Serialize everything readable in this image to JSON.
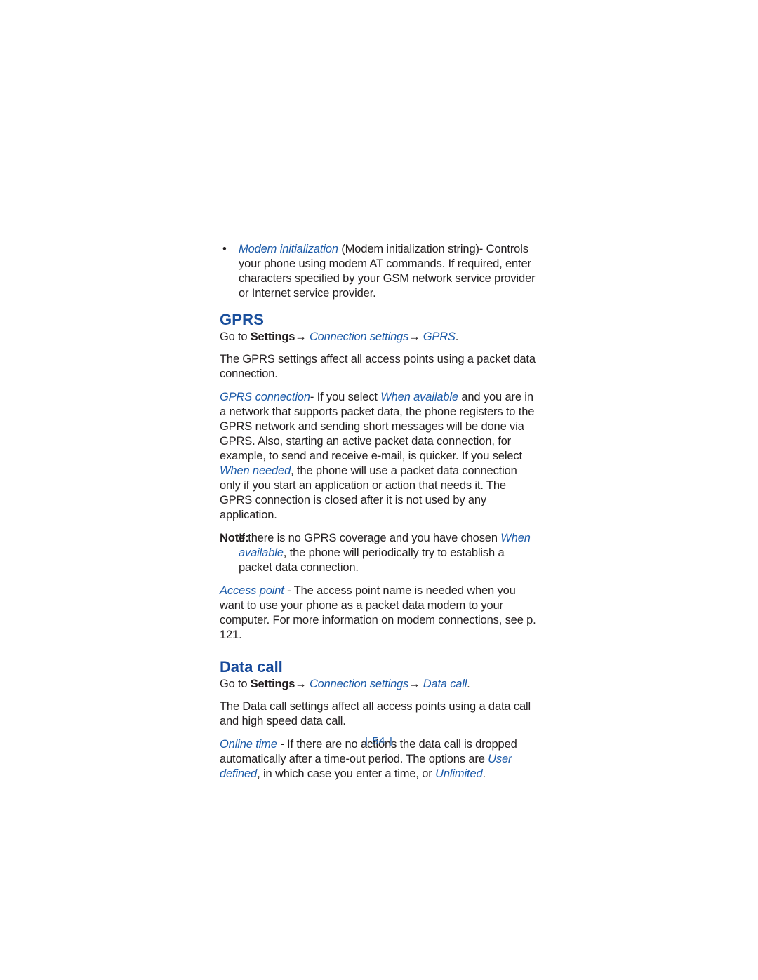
{
  "document": {
    "page_number_label": "[ 54 ]",
    "colors": {
      "heading_blue": "#1a4f9c",
      "inline_blue": "#1b5aa8",
      "body_text": "#231f20",
      "page_background": "#ffffff"
    }
  },
  "bullets": [
    {
      "marker": "•",
      "term": "Modem initialization",
      "rest": " (Modem initialization string)- Controls your phone using modem AT commands. If required, enter characters specified by your GSM network service provider or Internet service provider."
    }
  ],
  "sections": [
    {
      "id": "gprs",
      "heading": "GPRS",
      "path": {
        "lead": "Go to ",
        "step1": "Settings",
        "arrow1": "→",
        "step2": " Connection settings",
        "arrow2": "→",
        "step3": " GPRS",
        "period": "."
      },
      "intro": "The GPRS settings affect all access points using a packet data connection.",
      "paragraphs": [
        {
          "term": "GPRS connection",
          "part1": "- If you select ",
          "term2": "When available",
          "part2": " and you are in a network that supports packet data, the phone registers to the GPRS network and sending short messages will be done via GPRS. Also, starting an active packet data connection, for example, to send and receive e-mail, is quicker. If you select ",
          "term3": "When needed",
          "part3": ", the phone will use a packet data connection only if you start an application or action that needs it. The GPRS connection is closed after it is not used by any application."
        }
      ],
      "note": {
        "label": "Note:",
        "part1": "If there is no GPRS coverage and you have chosen ",
        "term": "When available",
        "part2": ", the phone will periodically try to establish a packet data connection."
      },
      "trailing_paragraph": {
        "term": "Access point",
        "rest": " - The access point name is needed when you want to use your phone as a packet data modem to your computer. For more information on modem connections, see p. 121."
      }
    },
    {
      "id": "data-call",
      "heading": "Data call",
      "path": {
        "lead": "Go to ",
        "step1": "Settings",
        "arrow1": "→",
        "step2": " Connection settings",
        "arrow2": "→",
        "step3": " Data call",
        "period": "."
      },
      "intro": "The Data call settings affect all access points using a data call and high speed data call.",
      "paragraphs": [
        {
          "term": "Online time",
          "part1": " - If there are no actions the data call is dropped automatically after a time-out period. The options are ",
          "term2": "User defined",
          "part2": ", in which case you enter a time, or ",
          "term3": "Unlimited",
          "part3": "."
        }
      ]
    }
  ]
}
